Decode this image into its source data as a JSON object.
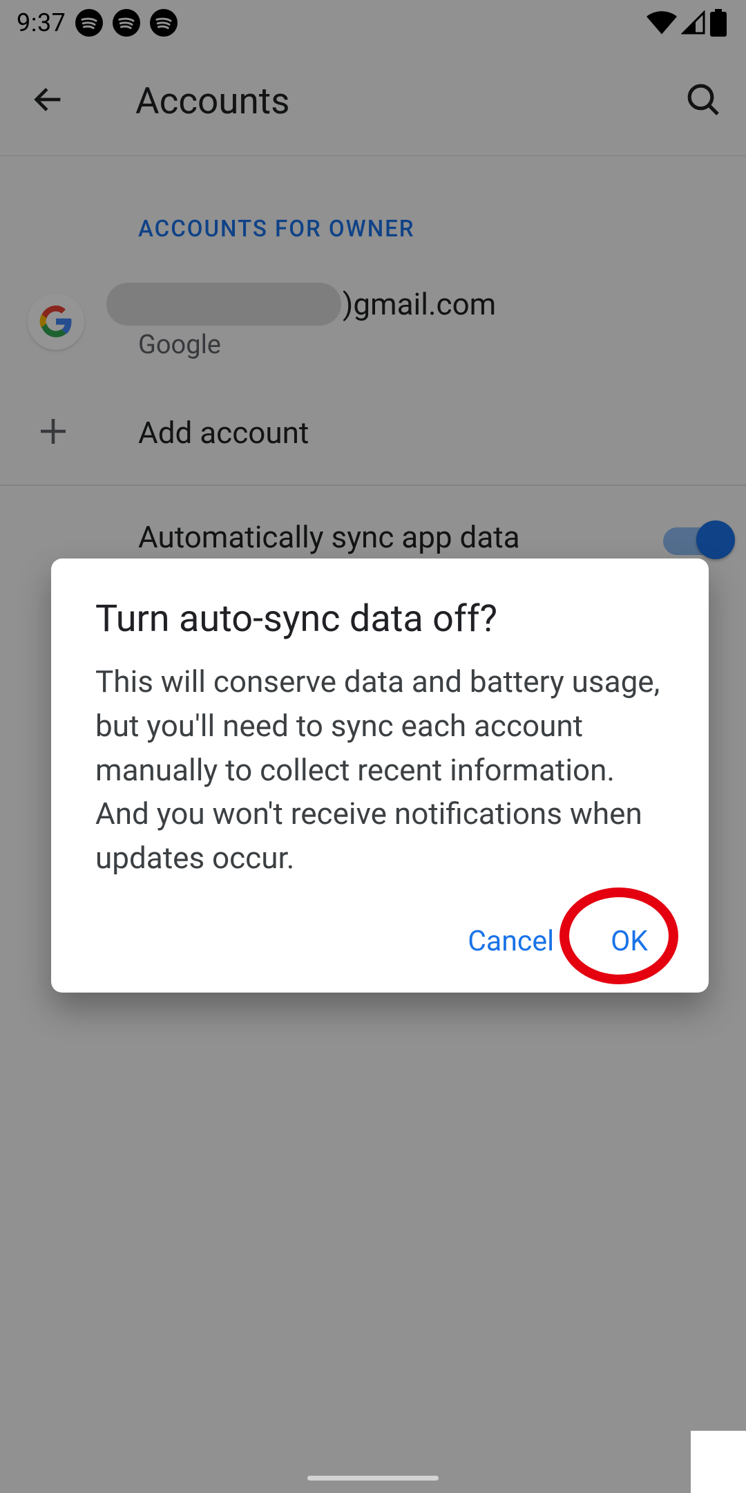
{
  "status": {
    "time": "9:37"
  },
  "appbar": {
    "title": "Accounts"
  },
  "section_header": "ACCOUNTS FOR OWNER",
  "account": {
    "email_suffix": ")gmail.com",
    "provider": "Google"
  },
  "add_account": {
    "label": "Add account"
  },
  "auto_sync": {
    "label": "Automatically sync app data"
  },
  "dialog": {
    "title": "Turn auto-sync data off?",
    "body": "This will conserve data and battery usage, but you'll need to sync each account manually to collect recent information. And you won't receive notifications when updates occur.",
    "cancel": "Cancel",
    "ok": "OK"
  }
}
